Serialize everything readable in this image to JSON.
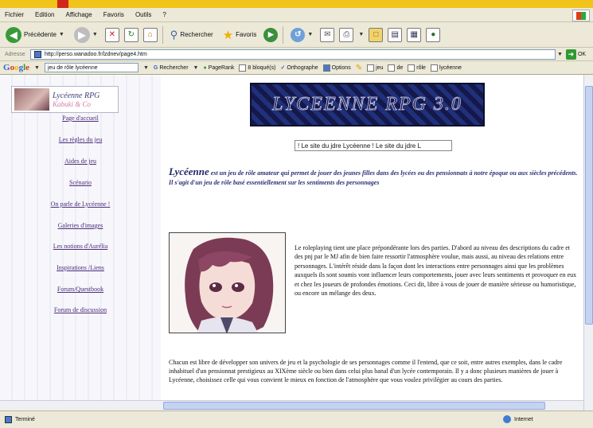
{
  "menubar": {
    "items": [
      "Fichier",
      "Edition",
      "Affichage",
      "Favoris",
      "Outils",
      "?"
    ]
  },
  "toolbar": {
    "back_label": "Précédente",
    "search_label": "Rechercher",
    "favorites_label": "Favoris"
  },
  "address": {
    "label": "Adresse",
    "url": "http://perso.wanadoo.fr/lzdnev/page4.htm",
    "go_label": "OK"
  },
  "googlebar": {
    "logo": "Google",
    "query": "jeu de rôle lycéenne",
    "search_label": "Rechercher",
    "pagerank_label": "PageRank",
    "blocked_label": "8 bloqué(s)",
    "spell_label": "Orthographe",
    "options_label": "Options",
    "terms": [
      "jeu",
      "de",
      "rôle",
      "lycéenne"
    ]
  },
  "sidebar": {
    "logo_title": "Lycéenne RPG",
    "logo_subtitle": "Kabuki & Co",
    "links": [
      "Page d'accueil",
      "Les règles du jeu",
      "Aides de jeu",
      "Scénario",
      "On parle de Lycéenne !",
      "Galeries d'images",
      "Les notions d'Aurélia",
      "Inspirations /Liens",
      "Forum/Questbook",
      "Forum de discussion"
    ]
  },
  "main": {
    "banner": "LYCEENNE RPG 3.0",
    "marquee": "! Le site du jdre Lycéenne ! Le site du jdre L",
    "intro_lead": "Lycéenne",
    "intro_text": " est un jeu de rôle amateur qui permet de jouer des jeunes filles dans des lycées ou des pensionnats à notre époque ou aux siècles précédents. Il s'agit d'un jeu de rôle basé essentiellement sur les sentiments des personnages",
    "description": "Le roleplaying tient une place prépondérante lors des parties. D'abord au niveau des descriptions du cadre et des pnj par le MJ afin de bien faire ressortir l'atmosphère voulue, mais aussi, au niveau des relations entre personnages. L'intérêt réside dans la façon dont les interactions entre personnages ainsi que les problèmes auxquels ils sont soumis vont influencer leurs comportements, jouer avec leurs sentiments et provoquer en eux et chez les joueurs de profondes émotions. Ceci dit, libre à vous de jouer de manière sérieuse ou humoristique, ou encore un mélange des deux.",
    "paragraph2": "Chacun est libre de développer son univers de jeu et la psychologie de ses personnages comme il l'entend, que ce soit, entre autres exemples, dans le cadre inhabituel d'un pensionnat prestigieux au XIXème siècle ou bien dans celui plus banal d'un lycée contemporain. Il y a donc plusieurs manières de jouer à Lycéenne, choisissez celle qui vous convient le mieux en fonction de l'atmosphère que vous voulez privilégier au cours des parties."
  },
  "statusbar": {
    "left": "Terminé",
    "zone": "Internet"
  },
  "colors": {
    "link": "#4b2d7a",
    "intro_text": "#2a2f78",
    "banner_bg": "#14184a"
  }
}
